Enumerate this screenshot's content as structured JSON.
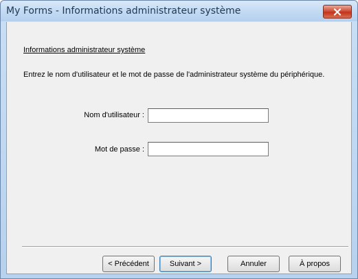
{
  "window": {
    "title": "My Forms - Informations administrateur système"
  },
  "content": {
    "heading": "Informations administrateur système",
    "description": "Entrez le nom d'utilisateur et le mot de passe de l'administrateur système du périphérique."
  },
  "form": {
    "username_label": "Nom d'utilisateur :",
    "username_value": "",
    "password_label": "Mot de passe :",
    "password_value": ""
  },
  "buttons": {
    "previous": "< Précédent",
    "next": "Suivant >",
    "cancel": "Annuler",
    "about": "À propos"
  },
  "colors": {
    "close_button": "#c8432d",
    "title_bar": "#c4dbf3",
    "client_background": "#f0f0f0"
  },
  "icons": {
    "close": "close-icon"
  }
}
